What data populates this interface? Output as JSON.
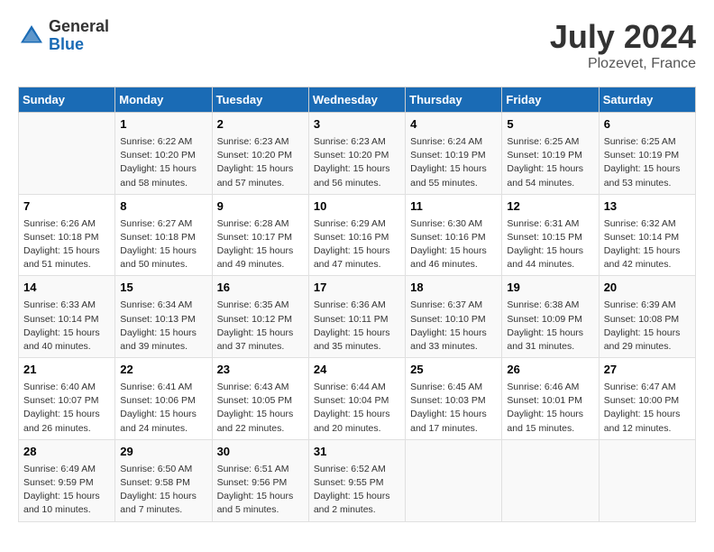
{
  "header": {
    "logo_general": "General",
    "logo_blue": "Blue",
    "month_title": "July 2024",
    "location": "Plozevet, France"
  },
  "days_of_week": [
    "Sunday",
    "Monday",
    "Tuesday",
    "Wednesday",
    "Thursday",
    "Friday",
    "Saturday"
  ],
  "weeks": [
    [
      {
        "day": "",
        "info": ""
      },
      {
        "day": "1",
        "info": "Sunrise: 6:22 AM\nSunset: 10:20 PM\nDaylight: 15 hours\nand 58 minutes."
      },
      {
        "day": "2",
        "info": "Sunrise: 6:23 AM\nSunset: 10:20 PM\nDaylight: 15 hours\nand 57 minutes."
      },
      {
        "day": "3",
        "info": "Sunrise: 6:23 AM\nSunset: 10:20 PM\nDaylight: 15 hours\nand 56 minutes."
      },
      {
        "day": "4",
        "info": "Sunrise: 6:24 AM\nSunset: 10:19 PM\nDaylight: 15 hours\nand 55 minutes."
      },
      {
        "day": "5",
        "info": "Sunrise: 6:25 AM\nSunset: 10:19 PM\nDaylight: 15 hours\nand 54 minutes."
      },
      {
        "day": "6",
        "info": "Sunrise: 6:25 AM\nSunset: 10:19 PM\nDaylight: 15 hours\nand 53 minutes."
      }
    ],
    [
      {
        "day": "7",
        "info": "Sunrise: 6:26 AM\nSunset: 10:18 PM\nDaylight: 15 hours\nand 51 minutes."
      },
      {
        "day": "8",
        "info": "Sunrise: 6:27 AM\nSunset: 10:18 PM\nDaylight: 15 hours\nand 50 minutes."
      },
      {
        "day": "9",
        "info": "Sunrise: 6:28 AM\nSunset: 10:17 PM\nDaylight: 15 hours\nand 49 minutes."
      },
      {
        "day": "10",
        "info": "Sunrise: 6:29 AM\nSunset: 10:16 PM\nDaylight: 15 hours\nand 47 minutes."
      },
      {
        "day": "11",
        "info": "Sunrise: 6:30 AM\nSunset: 10:16 PM\nDaylight: 15 hours\nand 46 minutes."
      },
      {
        "day": "12",
        "info": "Sunrise: 6:31 AM\nSunset: 10:15 PM\nDaylight: 15 hours\nand 44 minutes."
      },
      {
        "day": "13",
        "info": "Sunrise: 6:32 AM\nSunset: 10:14 PM\nDaylight: 15 hours\nand 42 minutes."
      }
    ],
    [
      {
        "day": "14",
        "info": "Sunrise: 6:33 AM\nSunset: 10:14 PM\nDaylight: 15 hours\nand 40 minutes."
      },
      {
        "day": "15",
        "info": "Sunrise: 6:34 AM\nSunset: 10:13 PM\nDaylight: 15 hours\nand 39 minutes."
      },
      {
        "day": "16",
        "info": "Sunrise: 6:35 AM\nSunset: 10:12 PM\nDaylight: 15 hours\nand 37 minutes."
      },
      {
        "day": "17",
        "info": "Sunrise: 6:36 AM\nSunset: 10:11 PM\nDaylight: 15 hours\nand 35 minutes."
      },
      {
        "day": "18",
        "info": "Sunrise: 6:37 AM\nSunset: 10:10 PM\nDaylight: 15 hours\nand 33 minutes."
      },
      {
        "day": "19",
        "info": "Sunrise: 6:38 AM\nSunset: 10:09 PM\nDaylight: 15 hours\nand 31 minutes."
      },
      {
        "day": "20",
        "info": "Sunrise: 6:39 AM\nSunset: 10:08 PM\nDaylight: 15 hours\nand 29 minutes."
      }
    ],
    [
      {
        "day": "21",
        "info": "Sunrise: 6:40 AM\nSunset: 10:07 PM\nDaylight: 15 hours\nand 26 minutes."
      },
      {
        "day": "22",
        "info": "Sunrise: 6:41 AM\nSunset: 10:06 PM\nDaylight: 15 hours\nand 24 minutes."
      },
      {
        "day": "23",
        "info": "Sunrise: 6:43 AM\nSunset: 10:05 PM\nDaylight: 15 hours\nand 22 minutes."
      },
      {
        "day": "24",
        "info": "Sunrise: 6:44 AM\nSunset: 10:04 PM\nDaylight: 15 hours\nand 20 minutes."
      },
      {
        "day": "25",
        "info": "Sunrise: 6:45 AM\nSunset: 10:03 PM\nDaylight: 15 hours\nand 17 minutes."
      },
      {
        "day": "26",
        "info": "Sunrise: 6:46 AM\nSunset: 10:01 PM\nDaylight: 15 hours\nand 15 minutes."
      },
      {
        "day": "27",
        "info": "Sunrise: 6:47 AM\nSunset: 10:00 PM\nDaylight: 15 hours\nand 12 minutes."
      }
    ],
    [
      {
        "day": "28",
        "info": "Sunrise: 6:49 AM\nSunset: 9:59 PM\nDaylight: 15 hours\nand 10 minutes."
      },
      {
        "day": "29",
        "info": "Sunrise: 6:50 AM\nSunset: 9:58 PM\nDaylight: 15 hours\nand 7 minutes."
      },
      {
        "day": "30",
        "info": "Sunrise: 6:51 AM\nSunset: 9:56 PM\nDaylight: 15 hours\nand 5 minutes."
      },
      {
        "day": "31",
        "info": "Sunrise: 6:52 AM\nSunset: 9:55 PM\nDaylight: 15 hours\nand 2 minutes."
      },
      {
        "day": "",
        "info": ""
      },
      {
        "day": "",
        "info": ""
      },
      {
        "day": "",
        "info": ""
      }
    ]
  ]
}
